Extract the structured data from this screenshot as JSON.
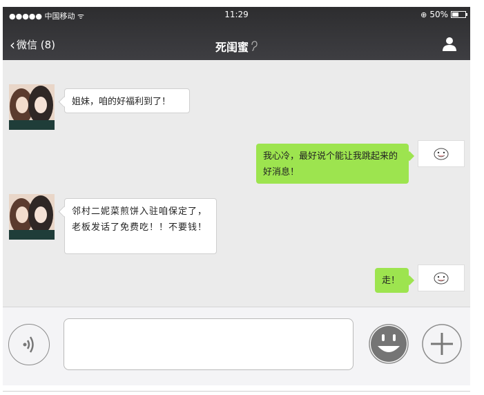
{
  "status": {
    "carrier": "●●●●● 中国移动 ᯤ",
    "time": "11:29",
    "battery_text": "50%",
    "battery_level": 0.5
  },
  "nav": {
    "back_label": "微信 (8)",
    "title": "死闺蜜",
    "ear_glyph": "ʖ"
  },
  "messages": [
    {
      "side": "left",
      "text": "姐妹，咱的好福利到了！"
    },
    {
      "side": "right",
      "text": "我心冷，最好说个能让我跳起来的好消息！"
    },
    {
      "side": "left",
      "text": "邻村二妮菜煎饼入驻咱保定了，老板发话了免费吃！！不要钱！"
    },
    {
      "side": "right",
      "text": "走！"
    }
  ],
  "input": {
    "value": ""
  },
  "colors": {
    "bubble_self": "#9de44f",
    "bubble_other": "#ffffff",
    "background": "#ebebeb",
    "topbar": "#2d2d2f"
  },
  "icons": {
    "back": "chevron-left-icon",
    "person": "person-icon",
    "voice": "voice-icon",
    "emoji": "emoji-icon",
    "plus": "plus-icon"
  }
}
